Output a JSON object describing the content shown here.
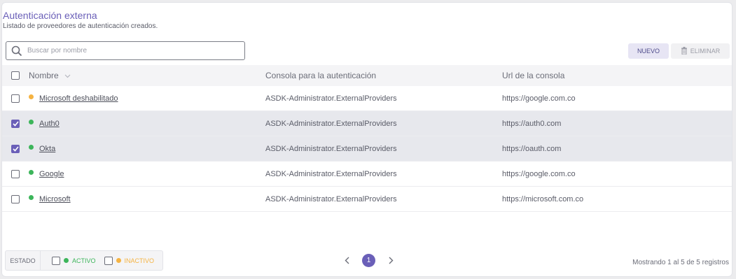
{
  "header": {
    "title": "Autenticación externa",
    "subtitle": "Listado de proveedores de autenticación creados."
  },
  "search": {
    "placeholder": "Buscar por nombre",
    "value": ""
  },
  "toolbar": {
    "new_label": "NUEVO",
    "delete_label": "ELIMINAR"
  },
  "table": {
    "columns": [
      "Nombre",
      "Consola para la autenticación",
      "Url de la consola"
    ],
    "rows": [
      {
        "name": "Microsoft deshabilitado",
        "console": "ASDK-Administrator.ExternalProviders",
        "url": "https://google.com.co",
        "status": "inactive",
        "checked": false
      },
      {
        "name": "Auth0",
        "console": "ASDK-Administrator.ExternalProviders",
        "url": "https://auth0.com",
        "status": "active",
        "checked": true
      },
      {
        "name": "Okta",
        "console": "ASDK-Administrator.ExternalProviders",
        "url": "https://oauth.com",
        "status": "active",
        "checked": true
      },
      {
        "name": "Google",
        "console": "ASDK-Administrator.ExternalProviders",
        "url": "https://google.com.co",
        "status": "active",
        "checked": false
      },
      {
        "name": "Microsoft",
        "console": "ASDK-Administrator.ExternalProviders",
        "url": "https://microsoft.com.co",
        "status": "active",
        "checked": false
      }
    ]
  },
  "footer": {
    "status_label": "ESTADO",
    "active_label": "ACTIVO",
    "inactive_label": "INACTIVO",
    "current_page": "1",
    "showing": "Mostrando 1 al 5 de 5 registros"
  },
  "colors": {
    "accent": "#6a5fb8",
    "active": "#3cb55a",
    "inactive": "#f5b342"
  }
}
